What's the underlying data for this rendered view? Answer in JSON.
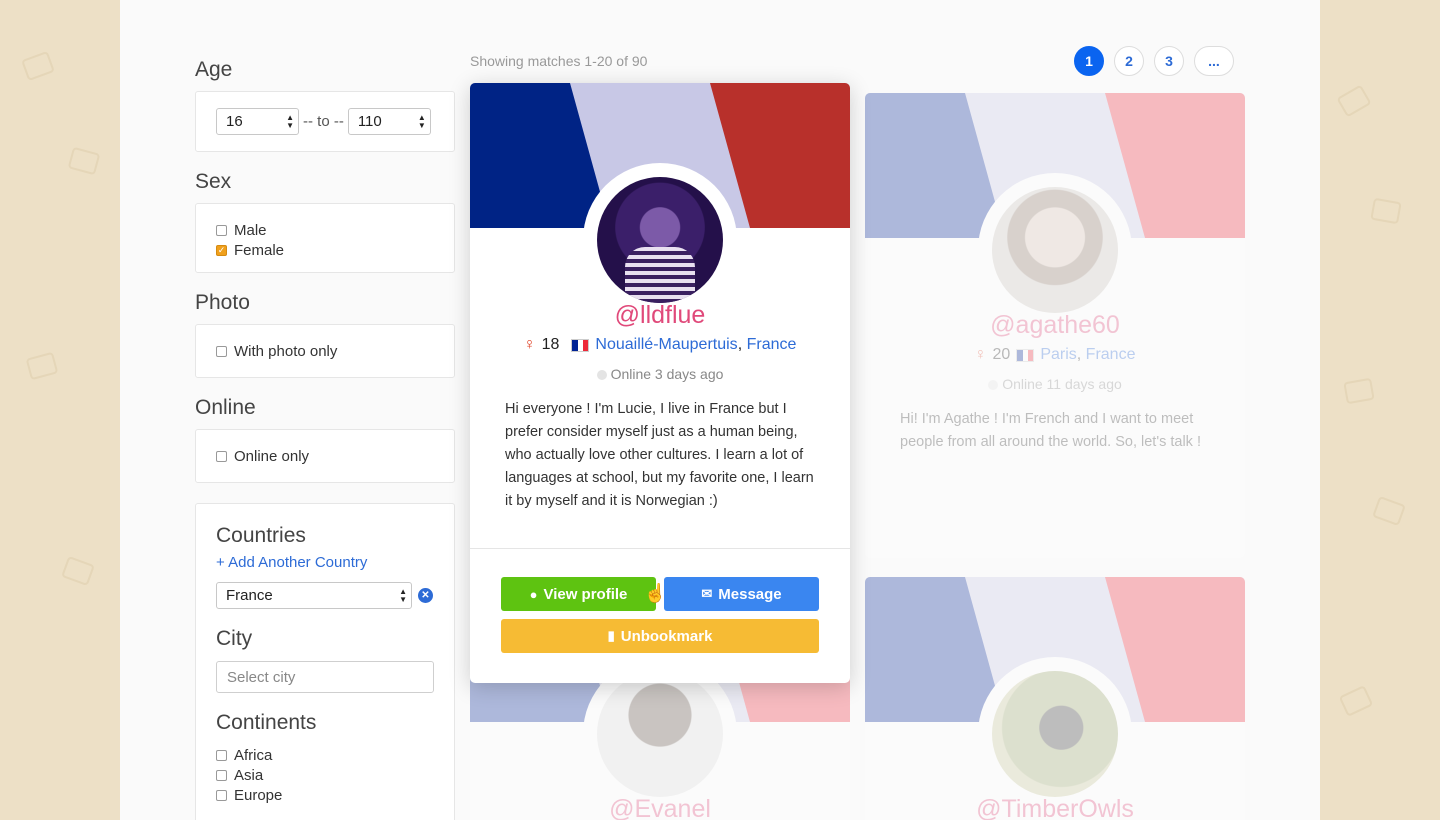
{
  "filters": {
    "age": {
      "title": "Age",
      "min": "16",
      "separator": "-- to --",
      "max": "110"
    },
    "sex": {
      "title": "Sex",
      "options": [
        {
          "label": "Male",
          "checked": false
        },
        {
          "label": "Female",
          "checked": true
        }
      ]
    },
    "photo": {
      "title": "Photo",
      "option": "With photo only"
    },
    "online": {
      "title": "Online",
      "option": "Online only"
    },
    "countries": {
      "title": "Countries",
      "add_link": "+ Add Another Country",
      "selected": "France"
    },
    "city": {
      "title": "City",
      "placeholder": "Select city"
    },
    "continents": {
      "title": "Continents",
      "options": [
        "Africa",
        "Asia",
        "Europe"
      ]
    }
  },
  "results": {
    "showing": "Showing matches 1-20 of 90",
    "pages": [
      "1",
      "2",
      "3",
      "..."
    ],
    "active_page": "1"
  },
  "profiles": [
    {
      "username": "@lldflue",
      "age": "18",
      "city": "Nouaillé-Maupertuis",
      "comma": ",",
      "country": "France",
      "online": "Online 3 days ago",
      "bio": "Hi everyone ! I'm Lucie, I live in France but I prefer consider myself just as a human being, who actually love other cultures. I learn a lot of languages at school, but my favorite one, I learn it by myself and it is Norwegian :)",
      "buttons": {
        "view": "View profile",
        "message": "Message",
        "unbookmark": "Unbookmark"
      }
    },
    {
      "username": "@agathe60",
      "age": "20",
      "city": "Paris",
      "comma": ",",
      "country": "France",
      "online": "Online 11 days ago",
      "bio": "Hi! I'm Agathe ! I'm French and I want to meet people from all around the world. So, let's talk !"
    },
    {
      "username": "@Evanel"
    },
    {
      "username": "@TimberOwls"
    }
  ],
  "colors": {
    "accent": "#2d6bd6",
    "username": "#e0497a",
    "view_btn": "#5ec311",
    "msg_btn": "#3a86f0",
    "unbookmark_btn": "#f6bb34"
  }
}
